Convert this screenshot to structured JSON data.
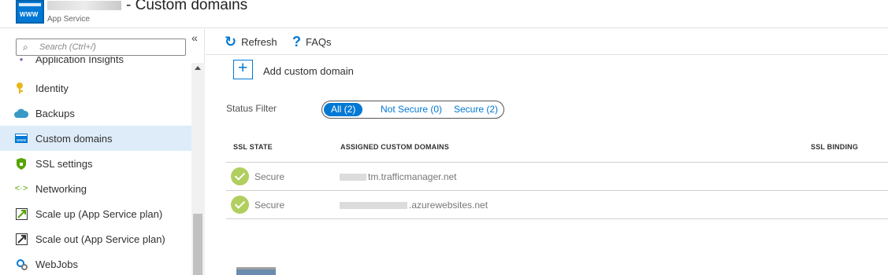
{
  "header": {
    "app_icon_text": "WWW",
    "title": "- Custom domains",
    "subtitle": "App Service"
  },
  "sidebar": {
    "search_placeholder": "Search (Ctrl+/)",
    "collapse_glyph": "«",
    "items": [
      {
        "label": "Application Insights",
        "icon": "application-insights-icon"
      },
      {
        "label": "Identity",
        "icon": "identity-icon"
      },
      {
        "label": "Backups",
        "icon": "backups-icon"
      },
      {
        "label": "Custom domains",
        "icon": "custom-domains-icon",
        "active": true
      },
      {
        "label": "SSL settings",
        "icon": "ssl-settings-icon"
      },
      {
        "label": "Networking",
        "icon": "networking-icon"
      },
      {
        "label": "Scale up (App Service plan)",
        "icon": "scale-up-icon"
      },
      {
        "label": "Scale out (App Service plan)",
        "icon": "scale-out-icon"
      },
      {
        "label": "WebJobs",
        "icon": "webjobs-icon"
      }
    ]
  },
  "toolbar": {
    "refresh_label": "Refresh",
    "faqs_label": "FAQs"
  },
  "main": {
    "add_label": "Add custom domain",
    "status_filter_label": "Status Filter",
    "filters": [
      {
        "label": "All (2)",
        "selected": true
      },
      {
        "label": "Not Secure (0)",
        "selected": false
      },
      {
        "label": "Secure (2)",
        "selected": false
      }
    ],
    "columns": [
      "SSL STATE",
      "ASSIGNED CUSTOM DOMAINS",
      "SSL BINDING"
    ],
    "rows": [
      {
        "ssl_state": "Secure",
        "domain": "tm.trafficmanager.net"
      },
      {
        "ssl_state": "Secure",
        "domain": ".azurewebsites.net"
      }
    ]
  },
  "colors": {
    "accent": "#0078d4",
    "active_nav": "#deecf9",
    "secure_check": "#b0cf5f"
  }
}
